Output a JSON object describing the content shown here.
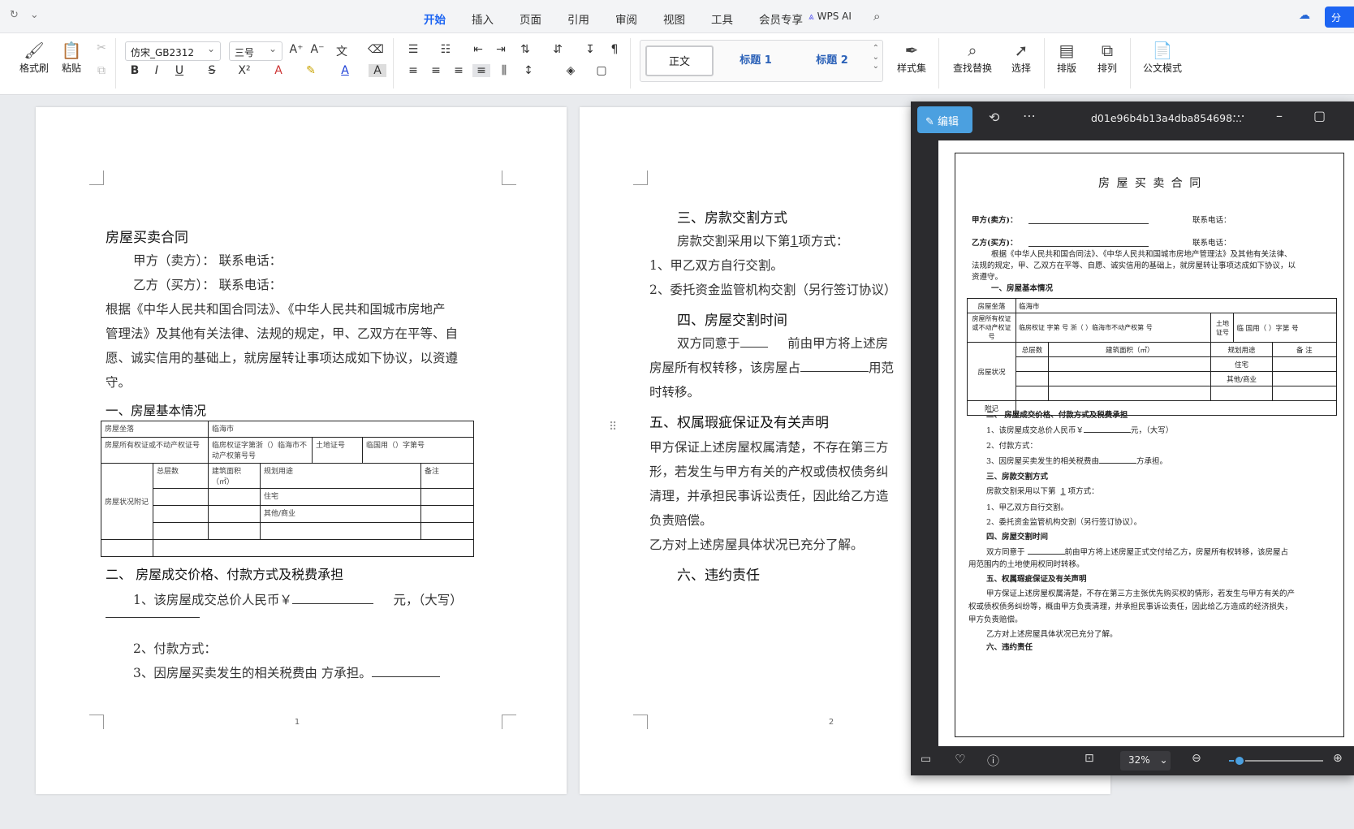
{
  "menubar": {
    "tabs": [
      "开始",
      "插入",
      "页面",
      "引用",
      "审阅",
      "视图",
      "工具",
      "会员专享"
    ],
    "active_tab": "开始",
    "wps_ai": "WPS AI",
    "share": "分"
  },
  "toolbar": {
    "format_painter": "格式刷",
    "paste": "粘贴",
    "font": "仿宋_GB2312",
    "size": "三号",
    "styles": [
      "正文",
      "标题 1",
      "标题 2"
    ],
    "style_set": "样式集",
    "find_replace": "查找替换",
    "select": "选择",
    "layout": "排版",
    "arrange": "排列",
    "official": "公文模式"
  },
  "page1": {
    "title": "房屋买卖合同",
    "party_a": "甲方（卖方）：        联系电话：",
    "party_b": "乙方（买方）：        联系电话：",
    "intro": [
      "根据《中华人民共和国合同法》、《中华人民共和国城市房地产",
      "管理法》及其他有关法律、法规的规定，甲、乙双方在平等、自",
      "愿、诚实信用的基础上，就房屋转让事项达成如下协议，以资遵",
      "守。"
    ],
    "sec1": "一、房屋基本情况",
    "table": {
      "r1": [
        "房屋坐落",
        "临海市"
      ],
      "r2": [
        "房屋所有权证或不动产权证号",
        "临房权证字第浙（）临海市不动产权第号号",
        "土地证号",
        "临国用（）字第号"
      ],
      "r3": [
        "房屋状况附记",
        "总层数",
        "建筑面积（㎡）",
        "规划用途",
        "备注"
      ],
      "r4": "住宅",
      "r5": "其他/商业"
    },
    "sec2": "二、  房屋成交价格、付款方式及税费承担",
    "item1": "1、该房屋成交总价人民币￥",
    "item1b": "元，（大写）",
    "item2": "2、付款方式：",
    "item3": "3、因房屋买卖发生的相关税费由     方承担。",
    "num": "1"
  },
  "page2": {
    "sec3": "三、房款交割方式",
    "l1a": "房款交割采用以下第",
    "l1n": "1",
    "l1b": "项方式：",
    "l2": "1、甲乙双方自行交割。",
    "l3": "2、委托资金监管机构交割（另行签订协议）",
    "sec4": "四、房屋交割时间",
    "l4a": "双方同意于",
    "l4b": "前由甲方将上述房",
    "l5a": "房屋所有权转移，该房屋占",
    "l5b": "用范",
    "l6": "时转移。",
    "sec5": "五、权属瑕疵保证及有关声明",
    "l7": "甲方保证上述房屋权属清楚，不存在第三方",
    "l8": "形，若发生与甲方有关的产权或债权债务纠",
    "l9": "清理，并承担民事诉讼责任，因此给乙方造",
    "l10": "负责赔偿。",
    "l11": "乙方对上述房屋具体状况已充分了解。",
    "sec6": "六、违约责任",
    "num": "2"
  },
  "viewer": {
    "edit": "编辑",
    "filename": "d01e96b4b13a4dba854698...",
    "zoom": "32%",
    "doc": {
      "title": "房 屋 买 卖 合 同",
      "a": "甲方(卖方)：",
      "a_tel": "联系电话：",
      "b": "乙方(买方)：",
      "b_tel": "联系电话：",
      "intro1": "根据《中华人民共和国合同法》、《中华人民共和国城市房地产管理法》及其他有关法律、",
      "intro2": "法规的规定，甲、乙双方在平等、自愿、诚实信用的基础上，就房屋转让事项达成如下协议，以",
      "intro3": "资遵守。",
      "s1": "一、房屋基本情况",
      "t_r1a": "房屋坐落",
      "t_r1b": "临海市",
      "t_r2a": "房屋所有权证或不动产权证号",
      "t_r2b": "临房权证         字第      号 浙（    ）临海市不动产权第      号",
      "t_r2c": "土地证号",
      "t_r2d": "临    国用（    ）字第      号",
      "t_h1": "总层数",
      "t_h2": "建筑面积（㎡）",
      "t_h3": "规划用途",
      "t_h4": "备 注",
      "t_side": "房屋状况",
      "t_res": "住宅",
      "t_com": "其他/商业",
      "t_note": "附记",
      "s2": "二、  房屋成交价格、付款方式及税费承担",
      "p1": "1、该房屋成交总价人民币￥",
      "p1b": "元，（大写）",
      "p2": "2、付款方式：",
      "p3a": "3、因房屋买卖发生的相关税费由",
      "p3b": "方承担。",
      "s3": "三、房款交割方式",
      "p4a": "房款交割采用以下第",
      "p4n": "1",
      "p4b": "项方式：",
      "p5": "1、甲乙双方自行交割。",
      "p6": "2、委托资金监管机构交割（另行签订协议）。",
      "s4": "四、房屋交割时间",
      "p7a": "双方同意于",
      "p7b": "前由甲方将上述房屋正式交付给乙方，房屋所有权转移，该房屋占",
      "p8": "用范围内的土地使用权同时转移。",
      "s5": "五、权属瑕疵保证及有关声明",
      "p9": "甲方保证上述房屋权属清楚，不存在第三方主张优先购买权的情形，若发生与甲方有关的产",
      "p10": "权或债权债务纠纷等，概由甲方负责清理，并承担民事诉讼责任，因此给乙方造成的经济损失，",
      "p11": "甲方负责赔偿。",
      "p12": "乙方对上述房屋具体状况已充分了解。",
      "s6": "六、违约责任"
    }
  }
}
